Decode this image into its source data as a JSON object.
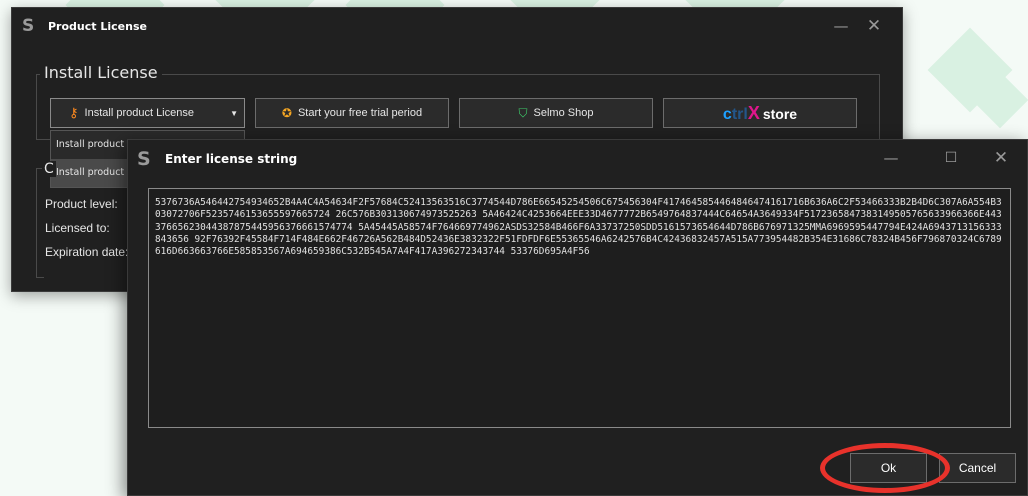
{
  "product_window": {
    "title": "Product License",
    "group_title": "Install License",
    "buttons": {
      "install": "Install product License",
      "trial": "Start your free trial period",
      "shop": "Selmo Shop",
      "ctrlx_c": "c",
      "ctrlx_trl": "trl",
      "ctrlx_x": "X",
      "ctrlx_store": "store"
    },
    "dropdown_items": [
      "Install product license from file",
      "Install product license from string"
    ],
    "info_group_title": "C",
    "info_labels": [
      "Product level:",
      "Licensed to:",
      "Expiration date:"
    ]
  },
  "license_dialog": {
    "title": "Enter license string",
    "license_text": "5376736A546442754934652B4A4C4A54634F2F57684C52413563516C3774544D786E66545254506C675456304F4174645854464846474161716B636A6C2F53466333B2B4D6C307A6A554B303072706F5235746153655597665724 26C576B303130674973525263 5A46424C4253664EEE33D4677772B6549764837444C64654A3649334F5172365847383149505765633966366E44337665623044387875445956376661574774 5A45445A58574F764669774962ASDS32584B466F6A33737250SDD5161573654644D786B676971325MMA6969595447794E424A6943713156333843656 92F76392F45584F714F484E662F46726A562B484D52436E3832322F51FDFDF6E55365546A6242576B4C42436832457A515A773954482B354E31686C78324B456F796870324C6789616D663663766E585853567A694659386C532B545A7A4F417A396272343744 53376D695A4F56",
    "ok_label": "Ok",
    "cancel_label": "Cancel"
  },
  "colors": {
    "window_bg": "#202020",
    "key_icon": "#ff8a1f",
    "trial_icon": "#f5a623",
    "shop_icon": "#3ecf6b",
    "ctrlx_blue": "#1ea0ff",
    "ctrlx_magenta": "#e0168c",
    "highlight_red": "#e8322b"
  },
  "icons": {
    "app_logo": "S",
    "key": "key-icon",
    "trial": "badge-icon",
    "shop": "shopping-bag-icon",
    "minimize": "minimize-icon",
    "maximize": "maximize-icon",
    "close": "close-icon"
  }
}
